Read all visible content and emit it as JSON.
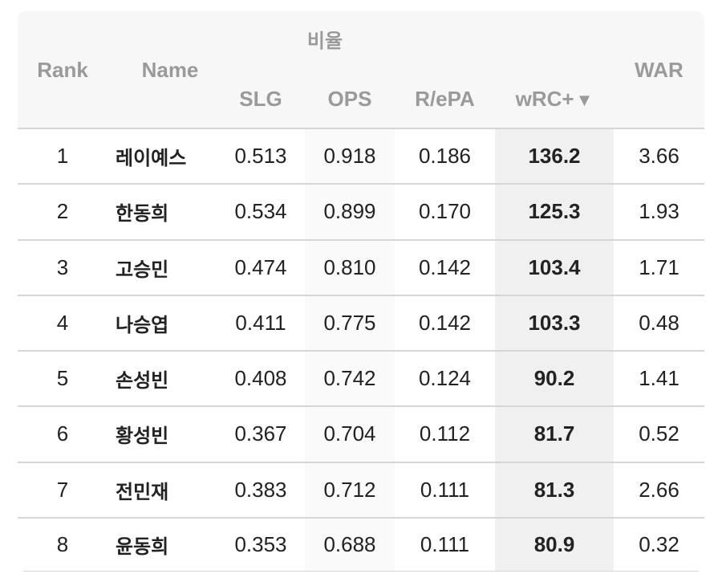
{
  "table": {
    "headers": {
      "rank": "Rank",
      "name": "Name",
      "group": "비율",
      "slg": "SLG",
      "ops": "OPS",
      "repa": "R/ePA",
      "wrc": "wRC+",
      "sort_indicator": "▼",
      "war": "WAR"
    },
    "rows": [
      {
        "rank": "1",
        "name": "레이예스",
        "slg": "0.513",
        "ops": "0.918",
        "repa": "0.186",
        "wrc": "136.2",
        "war": "3.66"
      },
      {
        "rank": "2",
        "name": "한동희",
        "slg": "0.534",
        "ops": "0.899",
        "repa": "0.170",
        "wrc": "125.3",
        "war": "1.93"
      },
      {
        "rank": "3",
        "name": "고승민",
        "slg": "0.474",
        "ops": "0.810",
        "repa": "0.142",
        "wrc": "103.4",
        "war": "1.71"
      },
      {
        "rank": "4",
        "name": "나승엽",
        "slg": "0.411",
        "ops": "0.775",
        "repa": "0.142",
        "wrc": "103.3",
        "war": "0.48"
      },
      {
        "rank": "5",
        "name": "손성빈",
        "slg": "0.408",
        "ops": "0.742",
        "repa": "0.124",
        "wrc": "90.2",
        "war": "1.41"
      },
      {
        "rank": "6",
        "name": "황성빈",
        "slg": "0.367",
        "ops": "0.704",
        "repa": "0.112",
        "wrc": "81.7",
        "war": "0.52"
      },
      {
        "rank": "7",
        "name": "전민재",
        "slg": "0.383",
        "ops": "0.712",
        "repa": "0.111",
        "wrc": "81.3",
        "war": "2.66"
      },
      {
        "rank": "8",
        "name": "윤동희",
        "slg": "0.353",
        "ops": "0.688",
        "repa": "0.111",
        "wrc": "80.9",
        "war": "0.32"
      }
    ]
  }
}
